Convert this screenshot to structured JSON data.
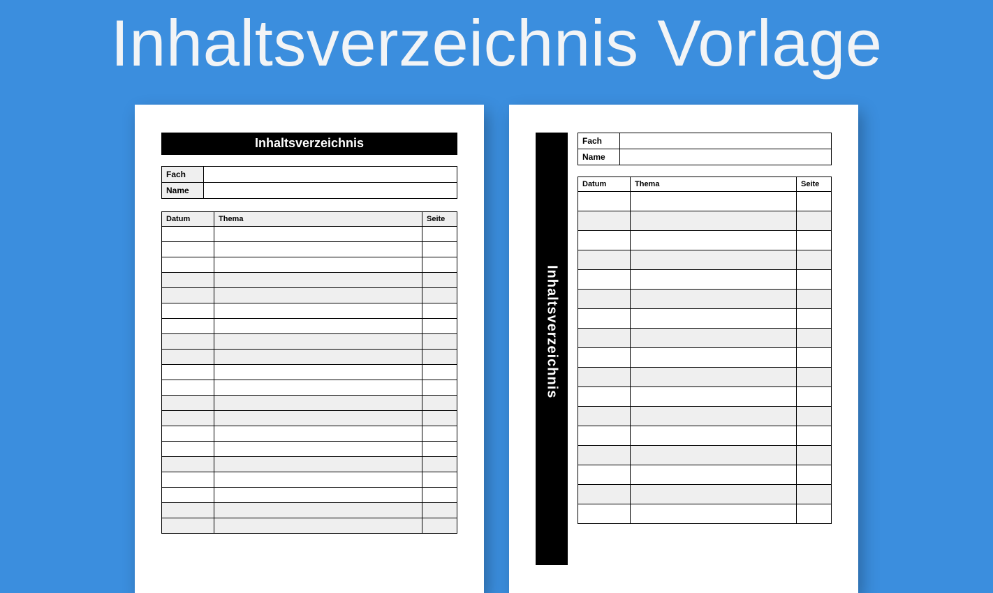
{
  "headline": "Inhaltsverzeichnis Vorlage",
  "templateA": {
    "banner": "Inhaltsverzeichnis",
    "info": {
      "fach_label": "Fach",
      "name_label": "Name"
    },
    "columns": {
      "datum": "Datum",
      "thema": "Thema",
      "seite": "Seite"
    },
    "row_count": 20,
    "shade_pattern": [
      0,
      0,
      0,
      1,
      1,
      0,
      0,
      1,
      1,
      0,
      0,
      1,
      1,
      0,
      0,
      1,
      0,
      0,
      1,
      1
    ]
  },
  "templateB": {
    "sidebar": "Inhaltsverzeichnis",
    "info": {
      "fach_label": "Fach",
      "name_label": "Name"
    },
    "columns": {
      "datum": "Datum",
      "thema": "Thema",
      "seite": "Seite"
    },
    "row_count": 17,
    "shade_pattern": [
      0,
      1,
      0,
      1,
      0,
      1,
      0,
      1,
      0,
      1,
      0,
      1,
      0,
      1,
      0,
      1,
      0
    ]
  }
}
